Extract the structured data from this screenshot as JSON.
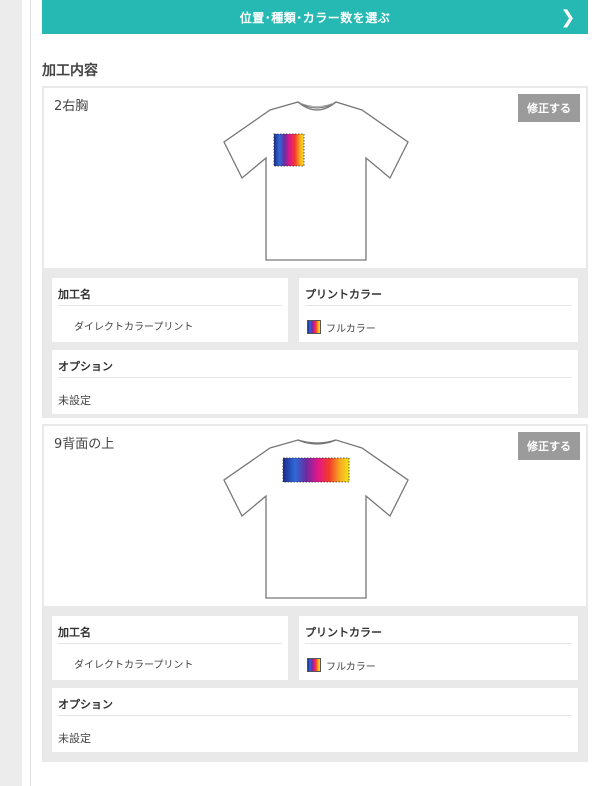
{
  "header": {
    "select_button_label": "位置･種類･カラー数を選ぶ"
  },
  "section_title": "加工内容",
  "items": [
    {
      "position": "2右胸",
      "edit_label": "修正する",
      "process_title": "加工名",
      "process_value": "ダイレクトカラープリント",
      "print_color_title": "プリントカラー",
      "print_color_value": "フルカラー",
      "option_title": "オプション",
      "option_value": "未設定",
      "view": "front"
    },
    {
      "position": "9背面の上",
      "edit_label": "修正する",
      "process_title": "加工名",
      "process_value": "ダイレクトカラープリント",
      "print_color_title": "プリントカラー",
      "print_color_value": "フルカラー",
      "option_title": "オプション",
      "option_value": "未設定",
      "view": "back"
    }
  ],
  "icons": {
    "chevron": "chevron-right-icon",
    "swatch": "full-color-swatch-icon"
  },
  "colors": {
    "accent": "#26b9b4",
    "edit_button": "#9b9b9b",
    "panel_bg": "#e9e9e9"
  }
}
